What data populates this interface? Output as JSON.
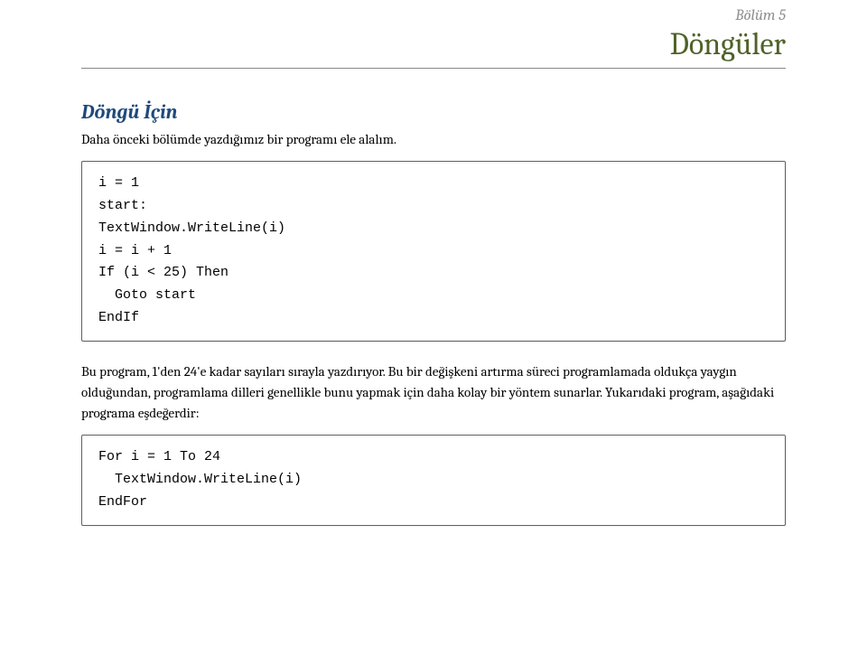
{
  "header": {
    "chapter_label": "Bölüm 5",
    "chapter_title": "Döngüler"
  },
  "section": {
    "heading": "Döngü İçin",
    "intro": "Daha önceki bölümde yazdığımız bir programı ele alalım."
  },
  "code1": "i = 1\nstart:\nTextWindow.WriteLine(i)\ni = i + 1\nIf (i < 25) Then\n  Goto start\nEndIf",
  "paragraph": "Bu program, 1'den 24'e kadar sayıları sırayla yazdırıyor. Bu bir değişkeni artırma süreci programlamada oldukça yaygın olduğundan, programlama dilleri genellikle bunu yapmak için daha kolay bir yöntem sunarlar. Yukarıdaki program, aşağıdaki programa eşdeğerdir:",
  "code2": "For i = 1 To 24\n  TextWindow.WriteLine(i)\nEndFor"
}
